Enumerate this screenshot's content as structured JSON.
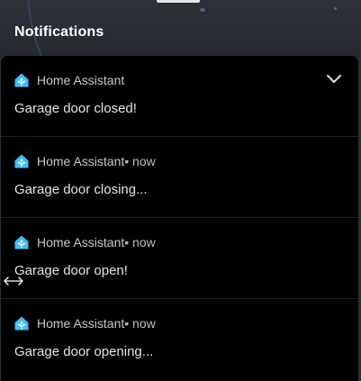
{
  "header": {
    "title": "Notifications"
  },
  "notifications": [
    {
      "app_name": "Home Assistant",
      "time": "",
      "message": "Garage door closed!",
      "expanded": true
    },
    {
      "app_name": "Home Assistant",
      "time": " • now",
      "message": "Garage door closing..."
    },
    {
      "app_name": "Home Assistant",
      "time": " • now",
      "message": "Garage door open!"
    },
    {
      "app_name": "Home Assistant",
      "time": " • now",
      "message": "Garage door opening..."
    }
  ],
  "icons": {
    "app": "home-assistant-icon",
    "expand": "chevron-down-icon",
    "cursor": "resize-horizontal-cursor-icon"
  },
  "colors": {
    "accent": "#41bdf5",
    "panel_bg": "#000000",
    "header_bg": "#2a2e35"
  }
}
